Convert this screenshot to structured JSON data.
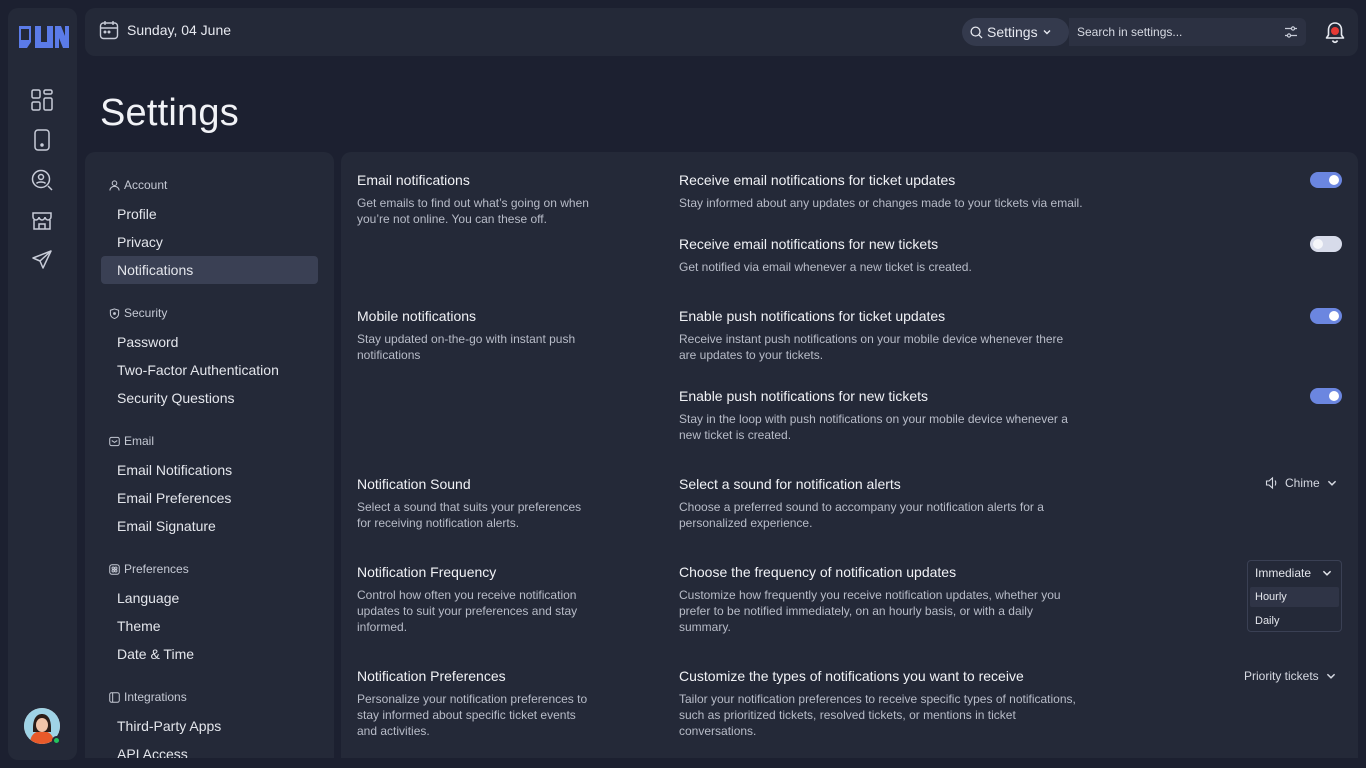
{
  "topbar": {
    "date": "Sunday, 04 June",
    "scope": "Settings",
    "search_placeholder": "Search in settings..."
  },
  "page_title": "Settings",
  "nav": {
    "groups": [
      {
        "label": "Account",
        "items": [
          "Profile",
          "Privacy",
          "Notifications"
        ]
      },
      {
        "label": "Security",
        "items": [
          "Password",
          "Two-Factor Authentication",
          "Security Questions"
        ]
      },
      {
        "label": "Email",
        "items": [
          "Email Notifications",
          "Email Preferences",
          "Email Signature"
        ]
      },
      {
        "label": "Preferences",
        "items": [
          "Language",
          "Theme",
          "Date & Time"
        ]
      },
      {
        "label": "Integrations",
        "items": [
          "Third-Party Apps",
          "API Access"
        ]
      }
    ],
    "active_item": "Notifications"
  },
  "sections": [
    {
      "title": "Email notifications",
      "desc": "Get emails to find out what’s going on when you’re not online. You can these off."
    },
    {
      "title": "Mobile notifications",
      "desc": "Stay updated on-the-go with instant push notifications"
    },
    {
      "title": "Notification Sound",
      "desc": "Select a sound that suits your preferences for receiving notification alerts."
    },
    {
      "title": "Notification Frequency",
      "desc": "Control how often you receive notification updates to suit your preferences and stay informed."
    },
    {
      "title": "Notification Preferences",
      "desc": "Personalize your notification preferences to stay informed about specific ticket events and activities."
    }
  ],
  "options": [
    {
      "title": "Receive email notifications for ticket updates",
      "desc": "Stay informed about any updates or changes made to your tickets via email.",
      "enabled": true
    },
    {
      "title": "Receive email notifications for new tickets",
      "desc": "Get notified via email whenever a new ticket is created.",
      "enabled": false
    },
    {
      "title": "Enable push notifications for ticket updates",
      "desc": "Receive instant push notifications on your mobile device whenever there are updates to your tickets.",
      "enabled": true
    },
    {
      "title": "Enable push notifications for new tickets",
      "desc": "Stay in the loop with push notifications on your mobile device whenever a new ticket is created.",
      "enabled": true
    },
    {
      "title": "Select a sound for notification alerts",
      "desc": "Choose a preferred sound to accompany your notification alerts for a personalized experience.",
      "value": "Chime"
    },
    {
      "title": "Choose the frequency of notification updates",
      "desc": "Customize how frequently you receive notification updates, whether you prefer to be notified immediately, on an hourly basis, or with a daily summary.",
      "value": "Immediate",
      "menu": [
        "Hourly",
        "Daily"
      ]
    },
    {
      "title": "Customize the types of notifications you want to receive",
      "desc": "Tailor your notification preferences to receive specific types of notifications, such as prioritized tickets, resolved tickets, or mentions in ticket conversations.",
      "value": "Priority tickets"
    }
  ],
  "colors": {
    "background": "#1c2030",
    "panel": "#242938",
    "accent": "#6b86e0",
    "logo": "#5b7be8",
    "online": "#22c55e",
    "bell_dot": "#e53935"
  },
  "icons": {
    "rail": [
      "dashboard-icon",
      "mobile-icon",
      "search-user-icon",
      "store-icon",
      "send-icon"
    ],
    "topbar": [
      "calendar-icon",
      "search-icon",
      "chevron-down-icon",
      "filter-icon",
      "bell-icon"
    ]
  }
}
